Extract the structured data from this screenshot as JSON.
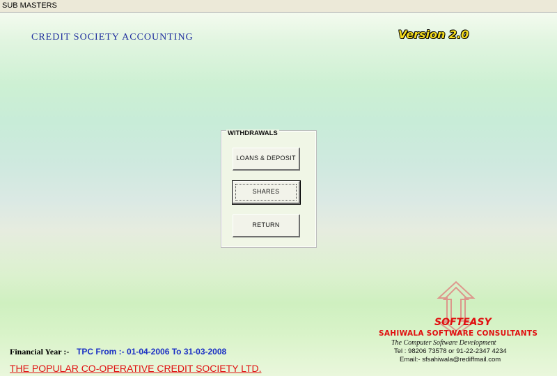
{
  "window": {
    "title": "SUB MASTERS"
  },
  "header": {
    "app_title": "CREDIT SOCIETY ACCOUNTING",
    "version": "Version 2.0"
  },
  "withdrawals": {
    "group_label": "WITHDRAWALS",
    "buttons": [
      {
        "label": "LOANS & DEPOSIT",
        "focused": false
      },
      {
        "label": "SHARES",
        "focused": true
      },
      {
        "label": "RETURN",
        "focused": false
      }
    ]
  },
  "footer": {
    "financial_year_label": "Financial Year :-",
    "financial_year_value": "TPC From :- 01-04-2006 To 31-03-2008",
    "society_name": "THE POPULAR CO-OPERATIVE CREDIT SOCIETY LTD."
  },
  "vendor": {
    "logo_name": "SOFTEASY",
    "company": "SAHIWALA SOFTWARE CONSULTANTS",
    "tagline": "The Computer Software Development",
    "tel": "Tel : 98206 73578 or 91-22-2347 4234",
    "email": "Email:- sfsahiwala@rediffmail.com",
    "logo_icon": "softeasy-arrows-logo"
  },
  "colors": {
    "title_blue": "#1f2e9e",
    "version_yellow": "#f4dc1f",
    "red": "#e01010",
    "fy_blue": "#1a2fc4"
  }
}
